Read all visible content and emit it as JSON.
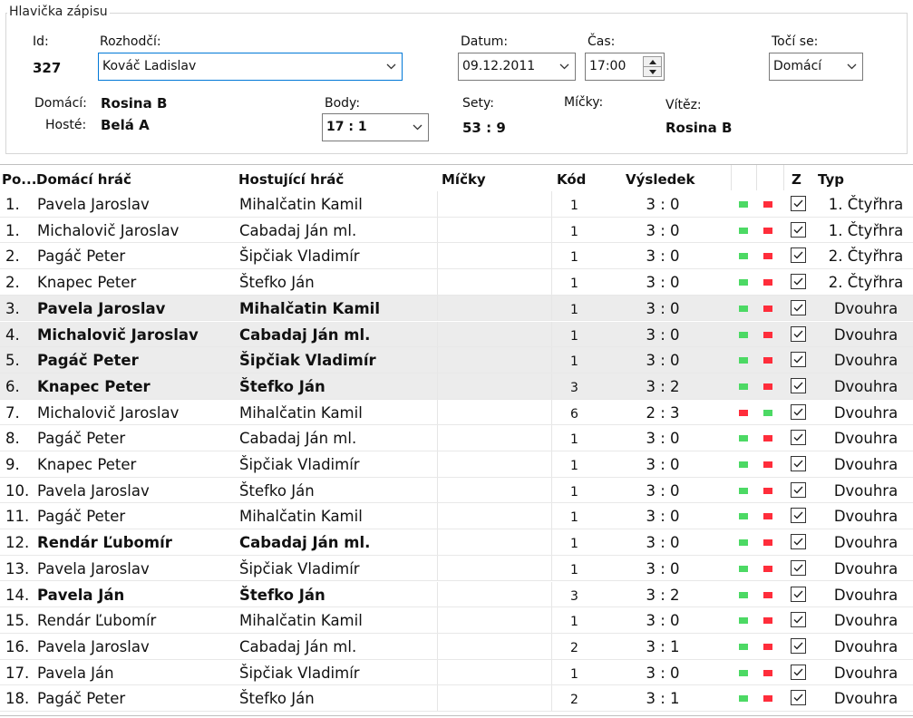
{
  "header": {
    "group_title": "Hlavička zápisu",
    "id_label": "Id:",
    "id_value": "327",
    "referee_label": "Rozhodčí:",
    "referee_value": "Kováč Ladislav",
    "date_label": "Datum:",
    "date_value": "09.12.2011",
    "time_label": "Čas:",
    "time_value": "17:00",
    "serve_label": "Točí se:",
    "serve_value": "Domácí",
    "home_label": "Domácí:",
    "home_value": "Rosina B",
    "away_label": "Hosté:",
    "away_value": "Belá A",
    "points_label": "Body:",
    "points_value": "17 : 1",
    "sets_label": "Sety:",
    "sets_value": "53 : 9",
    "balls_label": "Míčky:",
    "winner_label": "Vítěz:",
    "winner_value": "Rosina B"
  },
  "columns": {
    "order": "Po...",
    "home_player": "Domácí hráč",
    "away_player": "Hostující hráč",
    "balls": "Míčky",
    "code": "Kód",
    "result": "Výsledek",
    "z": "Z",
    "type": "Typ"
  },
  "colors": {
    "win": "#4cd964",
    "loss": "#ff2d3b",
    "selected_row": "#ececec",
    "focus_border": "#0078d7"
  },
  "rows": [
    {
      "order": "1.",
      "home": "Pavela Jaroslav",
      "away": "Mihalčatin Kamil",
      "code": "1",
      "result": "3 : 0",
      "home_won": true,
      "checked": true,
      "type": "1. Čtyřhra",
      "bold": false,
      "selected": false
    },
    {
      "order": "1.",
      "home": "Michalovič Jaroslav",
      "away": "Cabadaj Ján ml.",
      "code": "1",
      "result": "3 : 0",
      "home_won": true,
      "checked": true,
      "type": "1. Čtyřhra",
      "bold": false,
      "selected": false
    },
    {
      "order": "2.",
      "home": "Pagáč Peter",
      "away": "Šipčiak Vladimír",
      "code": "1",
      "result": "3 : 0",
      "home_won": true,
      "checked": true,
      "type": "2. Čtyřhra",
      "bold": false,
      "selected": false
    },
    {
      "order": "2.",
      "home": "Knapec Peter",
      "away": "Štefko Ján",
      "code": "1",
      "result": "3 : 0",
      "home_won": true,
      "checked": true,
      "type": "2. Čtyřhra",
      "bold": false,
      "selected": false
    },
    {
      "order": "3.",
      "home": "Pavela Jaroslav",
      "away": "Mihalčatin Kamil",
      "code": "1",
      "result": "3 : 0",
      "home_won": true,
      "checked": true,
      "type": "Dvouhra",
      "bold": true,
      "selected": true
    },
    {
      "order": "4.",
      "home": "Michalovič Jaroslav",
      "away": "Cabadaj Ján ml.",
      "code": "1",
      "result": "3 : 0",
      "home_won": true,
      "checked": true,
      "type": "Dvouhra",
      "bold": true,
      "selected": true
    },
    {
      "order": "5.",
      "home": "Pagáč Peter",
      "away": "Šipčiak Vladimír",
      "code": "1",
      "result": "3 : 0",
      "home_won": true,
      "checked": true,
      "type": "Dvouhra",
      "bold": true,
      "selected": true
    },
    {
      "order": "6.",
      "home": "Knapec Peter",
      "away": "Štefko Ján",
      "code": "3",
      "result": "3 : 2",
      "home_won": true,
      "checked": true,
      "type": "Dvouhra",
      "bold": true,
      "selected": true
    },
    {
      "order": "7.",
      "home": "Michalovič Jaroslav",
      "away": "Mihalčatin Kamil",
      "code": "6",
      "result": "2 : 3",
      "home_won": false,
      "checked": true,
      "type": "Dvouhra",
      "bold": false,
      "selected": false
    },
    {
      "order": "8.",
      "home": "Pagáč Peter",
      "away": "Cabadaj Ján ml.",
      "code": "1",
      "result": "3 : 0",
      "home_won": true,
      "checked": true,
      "type": "Dvouhra",
      "bold": false,
      "selected": false
    },
    {
      "order": "9.",
      "home": "Knapec Peter",
      "away": "Šipčiak Vladimír",
      "code": "1",
      "result": "3 : 0",
      "home_won": true,
      "checked": true,
      "type": "Dvouhra",
      "bold": false,
      "selected": false
    },
    {
      "order": "10.",
      "home": "Pavela Jaroslav",
      "away": "Štefko Ján",
      "code": "1",
      "result": "3 : 0",
      "home_won": true,
      "checked": true,
      "type": "Dvouhra",
      "bold": false,
      "selected": false
    },
    {
      "order": "11.",
      "home": "Pagáč Peter",
      "away": "Mihalčatin Kamil",
      "code": "1",
      "result": "3 : 0",
      "home_won": true,
      "checked": true,
      "type": "Dvouhra",
      "bold": false,
      "selected": false
    },
    {
      "order": "12.",
      "home": "Rendár Ľubomír",
      "away": "Cabadaj Ján ml.",
      "code": "1",
      "result": "3 : 0",
      "home_won": true,
      "checked": true,
      "type": "Dvouhra",
      "bold": true,
      "selected": false
    },
    {
      "order": "13.",
      "home": "Pavela Jaroslav",
      "away": "Šipčiak Vladimír",
      "code": "1",
      "result": "3 : 0",
      "home_won": true,
      "checked": true,
      "type": "Dvouhra",
      "bold": false,
      "selected": false
    },
    {
      "order": "14.",
      "home": "Pavela Ján",
      "away": "Štefko Ján",
      "code": "3",
      "result": "3 : 2",
      "home_won": true,
      "checked": true,
      "type": "Dvouhra",
      "bold": true,
      "selected": false
    },
    {
      "order": "15.",
      "home": "Rendár Ľubomír",
      "away": "Mihalčatin Kamil",
      "code": "1",
      "result": "3 : 0",
      "home_won": true,
      "checked": true,
      "type": "Dvouhra",
      "bold": false,
      "selected": false
    },
    {
      "order": "16.",
      "home": "Pavela Jaroslav",
      "away": "Cabadaj Ján ml.",
      "code": "2",
      "result": "3 : 1",
      "home_won": true,
      "checked": true,
      "type": "Dvouhra",
      "bold": false,
      "selected": false
    },
    {
      "order": "17.",
      "home": "Pavela Ján",
      "away": "Šipčiak Vladimír",
      "code": "1",
      "result": "3 : 0",
      "home_won": true,
      "checked": true,
      "type": "Dvouhra",
      "bold": false,
      "selected": false
    },
    {
      "order": "18.",
      "home": "Pagáč Peter",
      "away": "Štefko Ján",
      "code": "2",
      "result": "3 : 1",
      "home_won": true,
      "checked": true,
      "type": "Dvouhra",
      "bold": false,
      "selected": false
    }
  ]
}
